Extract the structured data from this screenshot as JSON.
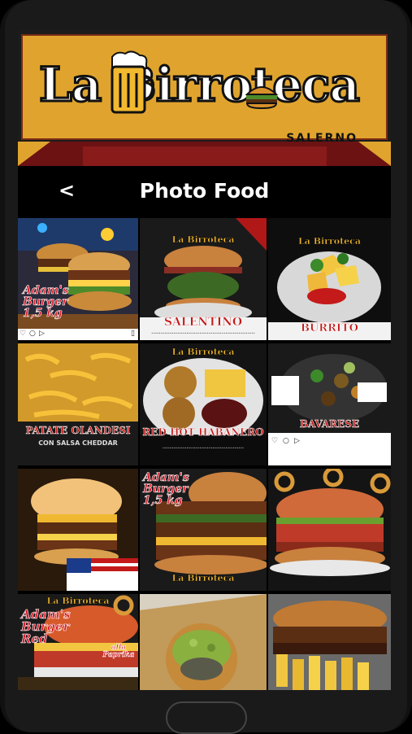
{
  "banner": {
    "logo_text": "La Birroteca",
    "location": "SALERNO",
    "icons": [
      "beer-mug-icon",
      "burger-icon"
    ]
  },
  "nav": {
    "back_label": "<",
    "title": "Photo Food"
  },
  "tiles": [
    {
      "caption": "",
      "stamp_lines": [
        "Adam's",
        "Burger",
        "1,5 kg"
      ]
    },
    {
      "caption": "SALENTINO",
      "logo": "La Birroteca"
    },
    {
      "caption": "BURRITO",
      "logo": "La Birroteca"
    },
    {
      "caption": "PATATE OLANDESI",
      "subcaption": "CON SALSA CHEDDAR"
    },
    {
      "caption": "RED HOT HABANERO",
      "logo": "La Birroteca"
    },
    {
      "caption": "BAVARESE"
    },
    {
      "caption": ""
    },
    {
      "caption": "",
      "stamp_lines": [
        "Adam's",
        "Burger",
        "1,5 kg"
      ],
      "logo": "La Birroteca"
    },
    {
      "caption": ""
    },
    {
      "caption": "",
      "stamp_lines": [
        "Adam's",
        "Burger",
        "Red"
      ],
      "side_note": "alla Paprika",
      "logo": "La Birroteca"
    },
    {
      "caption": ""
    },
    {
      "caption": ""
    }
  ],
  "colors": {
    "banner_bg": "#e0a42e",
    "caption_red": "#c41616",
    "page_bg": "#000000"
  }
}
